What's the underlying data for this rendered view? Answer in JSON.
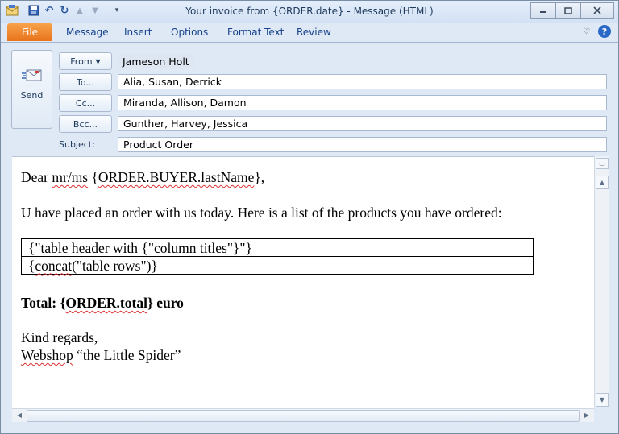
{
  "window": {
    "title": "Your invoice from {ORDER.date}  -  Message (HTML)"
  },
  "quick_access": {
    "icons": [
      "outlook-app-icon",
      "save-icon",
      "undo-icon",
      "redo-icon",
      "up-arrow-icon",
      "down-arrow-icon",
      "customize-qat-icon"
    ]
  },
  "ribbon": {
    "tabs": [
      "File",
      "Message",
      "Insert",
      "Options",
      "Format Text",
      "Review"
    ]
  },
  "header": {
    "send_label": "Send",
    "from_label": "From",
    "from_value": "Jameson Holt",
    "to_label": "To...",
    "to_value": "Alia, Susan, Derrick",
    "cc_label": "Cc...",
    "cc_value": "Miranda, Allison, Damon",
    "bcc_label": "Bcc...",
    "bcc_value": "Gunther, Harvey, Jessica",
    "subject_label": "Subject:",
    "subject_value": "Product Order"
  },
  "body": {
    "greeting_pre": "Dear ",
    "greeting_mr": "mr/ms",
    "greeting_space": " {",
    "greeting_field": "ORDER.BUYER.lastName",
    "greeting_post": "},",
    "intro": "U have placed an order with us today. Here is a list of the products you have ordered:",
    "table_row_1": "{\"table header with {\"column titles\"}\"}",
    "table_row_2_pre": "{",
    "table_row_2_concat": "concat",
    "table_row_2_post": "(\"table rows\")}",
    "total_pre": "Total: {",
    "total_field": "ORDER.total",
    "total_post": "} euro",
    "closing": "Kind regards,",
    "signature_word": "Webshop",
    "signature_rest": " “the Little Spider”"
  }
}
